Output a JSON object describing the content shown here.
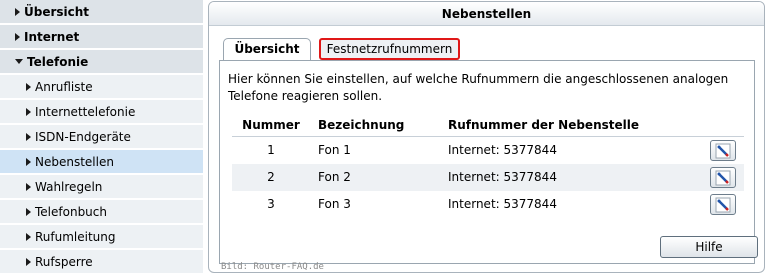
{
  "sidebar": {
    "items": [
      {
        "label": "Übersicht",
        "level": 1,
        "expanded": false
      },
      {
        "label": "Internet",
        "level": 1,
        "expanded": false
      },
      {
        "label": "Telefonie",
        "level": 1,
        "expanded": true
      },
      {
        "label": "Anrufliste",
        "level": 2
      },
      {
        "label": "Internettelefonie",
        "level": 2
      },
      {
        "label": "ISDN-Endgeräte",
        "level": 2
      },
      {
        "label": "Nebenstellen",
        "level": 2,
        "active": true
      },
      {
        "label": "Wahlregeln",
        "level": 2
      },
      {
        "label": "Telefonbuch",
        "level": 2
      },
      {
        "label": "Rufumleitung",
        "level": 2
      },
      {
        "label": "Rufsperre",
        "level": 2
      }
    ]
  },
  "panel": {
    "title": "Nebenstellen",
    "tabs": [
      {
        "label": "Übersicht",
        "active": true
      },
      {
        "label": "Festnetzrufnummern",
        "highlighted": true
      }
    ],
    "intro": "Hier können Sie einstellen, auf welche Rufnummern die angeschlossenen analogen Telefone reagieren sollen.",
    "table": {
      "headers": [
        "Nummer",
        "Bezeichnung",
        "Rufnummer der Nebenstelle"
      ],
      "rows": [
        {
          "num": "1",
          "bez": "Fon 1",
          "ruf": "Internet: 5377844"
        },
        {
          "num": "2",
          "bez": "Fon 2",
          "ruf": "Internet: 5377844"
        },
        {
          "num": "3",
          "bez": "Fon 3",
          "ruf": "Internet: 5377844"
        }
      ]
    },
    "help_label": "Hilfe",
    "credit": "Bild: Router-FAQ.de"
  },
  "colors": {
    "highlight": "#e01818",
    "active_nav": "#cfe3f5"
  }
}
